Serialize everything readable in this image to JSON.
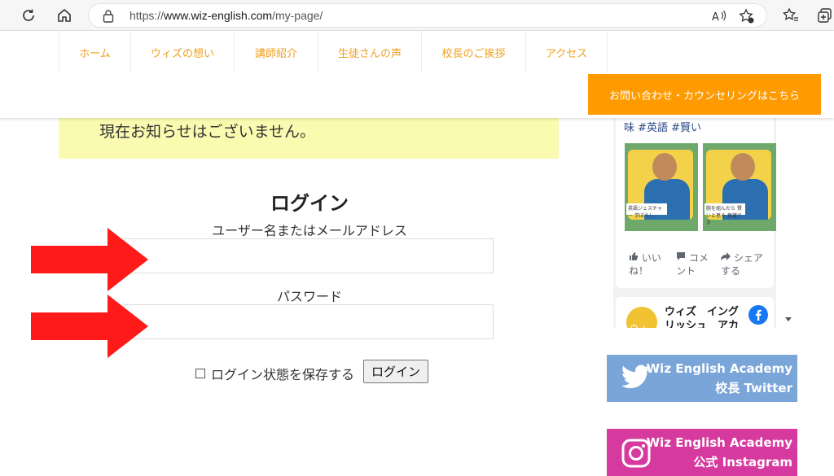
{
  "browser": {
    "url_prefix": "https://",
    "url_domain": "www.wiz-english.com",
    "url_path": "/my-page/"
  },
  "nav": {
    "items": [
      "ホーム",
      "ウィズの想い",
      "講師紹介",
      "生徒さんの声",
      "校長のご挨拶",
      "アクセス"
    ],
    "contact_button": "お問い合わせ・カウンセリングはこちら"
  },
  "notice": {
    "text": "現在お知らせはございません。"
  },
  "login": {
    "title": "ログイン",
    "username_label": "ユーザー名またはメールアドレス",
    "username_value": "",
    "password_label": "パスワード",
    "password_value": "",
    "remember_label": "ログイン状態を保存する",
    "submit_label": "ログイン"
  },
  "facebook": {
    "tags": "味 #英語 #賢い",
    "thumb1_caption": "英語ジェスチャー 学ぼう！",
    "thumb2_caption": "腕を組んだら 賢いと思う 意識です",
    "like": "いい\nね！",
    "comment": "コメ\nント",
    "share": "シェア\nする",
    "page_name": "ウィズ　イング\nリッシュ　アカ",
    "page_logo_text": "ウィ"
  },
  "banners": {
    "twitter_line1": "Wiz English Academy",
    "twitter_line2": "校長 Twitter",
    "twitter_color": "#7aa5d9",
    "instagram_line1": "Wiz English Academy",
    "instagram_line2": "公式 Instagram",
    "instagram_color": "#d63a9e"
  },
  "colors": {
    "accent": "#ff9a00",
    "nav_text": "#f0a020",
    "notice_bg": "#fafbb0",
    "arrow": "#ff1a1a"
  }
}
